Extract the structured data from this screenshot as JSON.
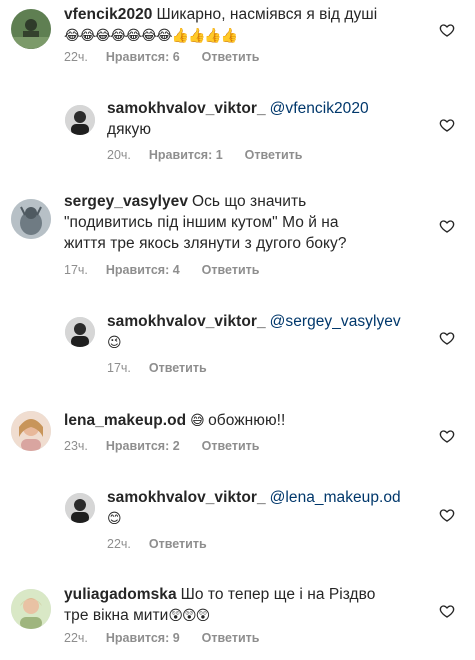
{
  "comments": [
    {
      "user": "vfencik2020",
      "text": "Шикарно, насміявся я від душі",
      "emoji": "😂😂😂😂😂😂😂👍👍👍👍",
      "time": "22ч.",
      "likes": "Нравится: 6",
      "reply": "Ответить"
    },
    {
      "user": "samokhvalov_viktor_",
      "mention": "@vfencik2020",
      "text": "дякую",
      "time": "20ч.",
      "likes": "Нравится: 1",
      "reply": "Ответить"
    },
    {
      "user": "sergey_vasylyev",
      "text_line1": "Ось що значить",
      "text_line2": "\"подивитись під іншим кутом\" Мо й на",
      "text_line3": "життя тре якось злянути з дугого боку?",
      "time": "17ч.",
      "likes": "Нравится: 4",
      "reply": "Ответить"
    },
    {
      "user": "samokhvalov_viktor_",
      "mention": "@sergey_vasylyev",
      "emoji": "😉",
      "time": "17ч.",
      "reply": "Ответить"
    },
    {
      "user": "lena_makeup.od",
      "emoji": "😅",
      "text": "обожнюю!!",
      "time": "23ч.",
      "likes": "Нравится: 2",
      "reply": "Ответить"
    },
    {
      "user": "samokhvalov_viktor_",
      "mention": "@lena_makeup.od",
      "emoji": "😊",
      "time": "22ч.",
      "reply": "Ответить"
    },
    {
      "user": "yuliagadomska",
      "text_line1": "Шо то тепер ще і на Різдво",
      "text_line2": "тре вікна мити",
      "emoji": "😲😲😲",
      "time": "22ч.",
      "likes": "Нравится: 9",
      "reply": "Ответить"
    }
  ],
  "icons": {
    "like": "heart-outline-icon"
  }
}
